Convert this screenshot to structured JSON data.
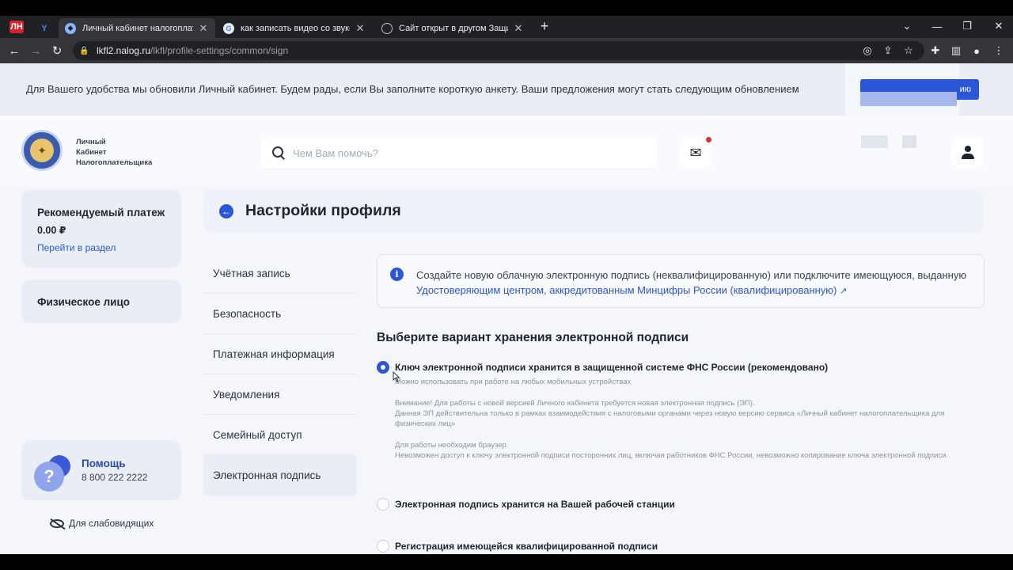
{
  "browser": {
    "pinned_tabs": [
      "ЛН",
      "Y"
    ],
    "tabs": [
      {
        "title": "Личный кабинет налогоплательщика",
        "active": true
      },
      {
        "title": "как записать видео со звуком с экрана",
        "active": false
      },
      {
        "title": "Сайт открыт в другом Защищенном",
        "active": false
      }
    ],
    "url_host": "lkfl2.nalog.ru",
    "url_path": "/lkfl/profile-settings/common/sign"
  },
  "banner": {
    "text": "Для Вашего удобства мы обновили Личный кабинет. Будем рады, если Вы заполните короткую анкету. Ваши предложения могут стать следующим обновлением",
    "button": "ию"
  },
  "header": {
    "brand_lines": [
      "Личный",
      "Кабинет",
      "Налогоплательщика"
    ],
    "search_placeholder": "Чем Вам помочь?"
  },
  "sidebar": {
    "payment_title": "Рекомендуемый платеж",
    "payment_value": "0.00 ₽",
    "payment_link": "Перейти в раздел",
    "person": "Физическое лицо",
    "help_title": "Помощь",
    "help_phone": "8 800 222 2222",
    "accessibility": "Для слабовидящих"
  },
  "main": {
    "title": "Настройки профиля",
    "menu": [
      {
        "label": "Учётная запись",
        "active": false
      },
      {
        "label": "Безопасность",
        "active": false
      },
      {
        "label": "Платежная информация",
        "active": false
      },
      {
        "label": "Уведомления",
        "active": false
      },
      {
        "label": "Семейный доступ",
        "active": false
      },
      {
        "label": "Электронная подпись",
        "active": true
      }
    ],
    "info_text": "Создайте новую облачную электронную подпись (неквалифицированную) или подключите имеющуюся, выданную ",
    "info_link": "Удостоверяющим центром, аккредитованным Минцифры России (квалифицированную)",
    "section_title": "Выберите вариант хранения электронной подписи",
    "options": [
      {
        "label": "Ключ электронной подписи хранится в защищенной системе ФНС России (рекомендовано)",
        "checked": true
      },
      {
        "label": "Электронная подпись хранится на Вашей рабочей станции",
        "checked": false
      },
      {
        "label": "Регистрация имеющейся квалифицированной подписи",
        "checked": false
      }
    ],
    "option1_note1": "Можно использовать при работе на любых мобильных устройствах",
    "option1_note2": "Внимание! Для работы с новой версией Личного кабинета требуется новая электронная подпись (ЭП).",
    "option1_note3": "Данная ЭП действительна только в рамках взаимодействия с налоговыми органами через новую версию сервиса «Личный кабинет налогоплательщика для физических лиц»",
    "option1_note4": "Для работы необходим браузер.",
    "option1_note5": "Невозможен доступ к ключу электронной подписи посторонних лиц, включая работников ФНС России, невозможно копирование ключа электронной подписи"
  }
}
